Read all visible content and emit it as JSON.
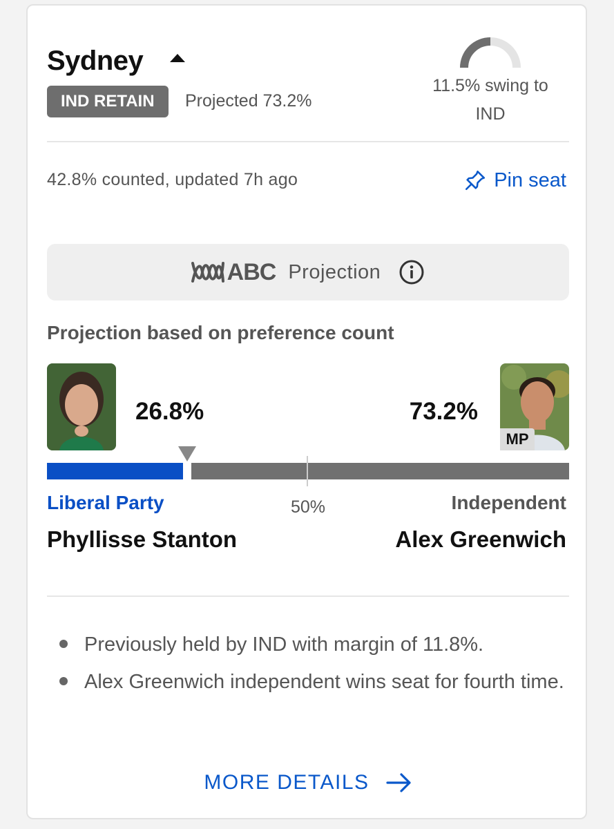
{
  "seat": {
    "name": "Sydney",
    "status_badge": "IND RETAIN",
    "projected_text": "Projected 73.2%",
    "swing_line1": "11.5% swing to",
    "swing_line2": "IND",
    "swing_gauge_fraction": 0.5
  },
  "count": {
    "text": "42.8% counted, updated 7h ago",
    "pin_label": "Pin seat"
  },
  "projection": {
    "logo_text": "ABC",
    "label": "Projection",
    "basis": "Projection based on preference count"
  },
  "candidates": {
    "left": {
      "percent_text": "26.8%",
      "percent_value": 26.8,
      "party": "Liberal Party",
      "name": "Phyllisse Stanton",
      "color": "#0a4fc5"
    },
    "right": {
      "percent_text": "73.2%",
      "percent_value": 73.2,
      "party": "Independent",
      "name": "Alex Greenwich",
      "tag": "MP",
      "color": "#707070"
    }
  },
  "bar": {
    "half_label": "50%"
  },
  "notes": [
    "Previously held by IND with margin of 11.8%.",
    "Alex Greenwich independent wins seat for fourth time."
  ],
  "more_label": "MORE DETAILS",
  "colors": {
    "accent": "#0a58ca",
    "liberal": "#0a4fc5",
    "independent": "#707070"
  }
}
